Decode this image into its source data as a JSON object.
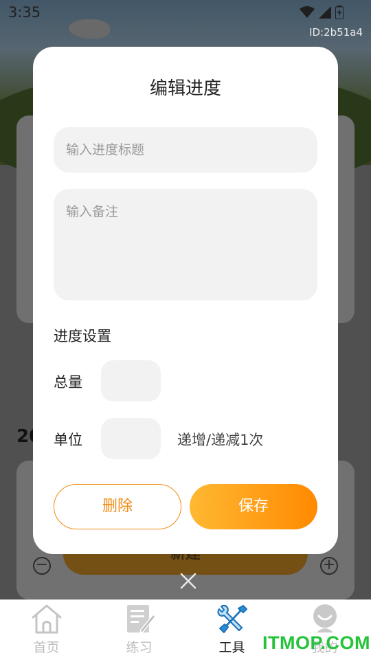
{
  "status_bar": {
    "time": "3:35",
    "device_id": "ID:2b51a4"
  },
  "background": {
    "year_prefix": "20",
    "new_button": "新建"
  },
  "dialog": {
    "title": "编辑进度",
    "title_placeholder": "输入进度标题",
    "note_placeholder": "输入备注",
    "section_label": "进度设置",
    "total_label": "总量",
    "unit_label": "单位",
    "step_text": "递增/递减1次",
    "delete_label": "删除",
    "save_label": "保存"
  },
  "nav": {
    "items": [
      {
        "label": "首页",
        "icon": "home-icon",
        "active": false
      },
      {
        "label": "练习",
        "icon": "practice-icon",
        "active": false
      },
      {
        "label": "工具",
        "icon": "tools-icon",
        "active": true
      },
      {
        "label": "我的",
        "icon": "profile-icon",
        "active": false
      }
    ]
  },
  "watermark": "ITMOP.COM",
  "colors": {
    "accent": "#ff8a00",
    "accent_light": "#ffb833",
    "active_icon": "#2a8fd6",
    "watermark": "#25c33a"
  }
}
